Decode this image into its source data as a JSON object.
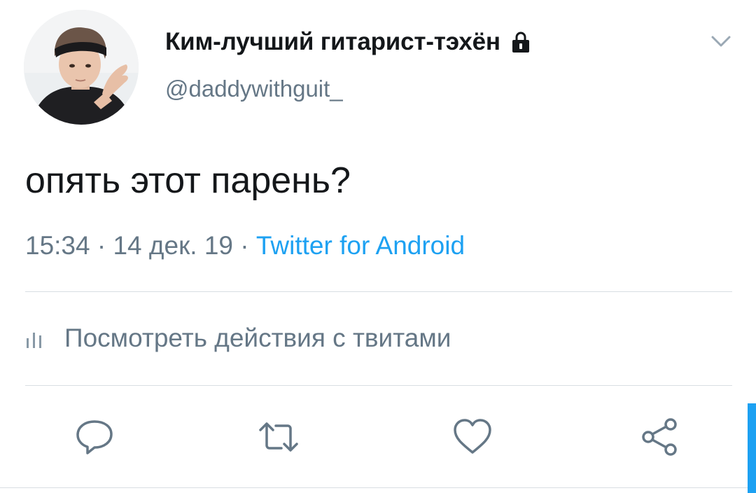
{
  "tweet": {
    "author": {
      "display_name": "Ким-лучший гитарист-тэхён",
      "handle": "@daddywithguit_",
      "protected_icon": "lock-icon",
      "avatar": "avatar-photo"
    },
    "menu_icon": "chevron-down-icon",
    "text": "опять этот парень?",
    "timestamp": "15:34 · 14 дек. 19 · ",
    "source": "Twitter for Android",
    "activity": {
      "icon": "analytics-icon",
      "label": "Посмотреть действия с твитами"
    },
    "actions": [
      {
        "name": "reply",
        "icon": "reply-icon"
      },
      {
        "name": "retweet",
        "icon": "retweet-icon"
      },
      {
        "name": "like",
        "icon": "heart-icon"
      },
      {
        "name": "share",
        "icon": "share-icon"
      }
    ]
  },
  "colors": {
    "text_primary": "#14171a",
    "text_secondary": "#657786",
    "accent": "#1da1f2",
    "divider": "#d8dee3"
  }
}
